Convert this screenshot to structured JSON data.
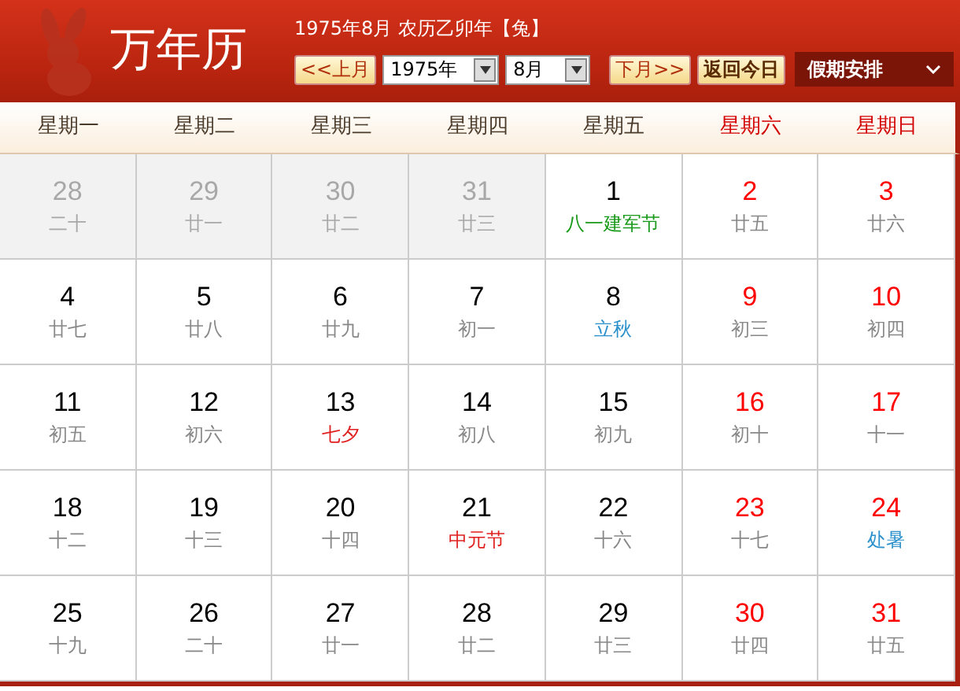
{
  "header": {
    "title": "万年历",
    "info": "1975年8月 农历乙卯年【兔】",
    "prev_button": "<<上月",
    "year_select": "1975年",
    "month_select": "8月",
    "next_button": "下月>>",
    "today_button": "返回今日",
    "holiday_menu": "假期安排"
  },
  "weekdays": [
    {
      "label": "星期一",
      "weekend": false
    },
    {
      "label": "星期二",
      "weekend": false
    },
    {
      "label": "星期三",
      "weekend": false
    },
    {
      "label": "星期四",
      "weekend": false
    },
    {
      "label": "星期五",
      "weekend": false
    },
    {
      "label": "星期六",
      "weekend": true
    },
    {
      "label": "星期日",
      "weekend": true
    }
  ],
  "weeks": [
    [
      {
        "day": "28",
        "note": "二十",
        "kind": "lunar",
        "other_month": true,
        "weekend": false
      },
      {
        "day": "29",
        "note": "廿一",
        "kind": "lunar",
        "other_month": true,
        "weekend": false
      },
      {
        "day": "30",
        "note": "廿二",
        "kind": "lunar",
        "other_month": true,
        "weekend": false
      },
      {
        "day": "31",
        "note": "廿三",
        "kind": "lunar",
        "other_month": true,
        "weekend": false
      },
      {
        "day": "1",
        "note": "八一建军节",
        "kind": "festival",
        "other_month": false,
        "weekend": false
      },
      {
        "day": "2",
        "note": "廿五",
        "kind": "lunar",
        "other_month": false,
        "weekend": true
      },
      {
        "day": "3",
        "note": "廿六",
        "kind": "lunar",
        "other_month": false,
        "weekend": true
      }
    ],
    [
      {
        "day": "4",
        "note": "廿七",
        "kind": "lunar",
        "other_month": false,
        "weekend": false
      },
      {
        "day": "5",
        "note": "廿八",
        "kind": "lunar",
        "other_month": false,
        "weekend": false
      },
      {
        "day": "6",
        "note": "廿九",
        "kind": "lunar",
        "other_month": false,
        "weekend": false
      },
      {
        "day": "7",
        "note": "初一",
        "kind": "lunar",
        "other_month": false,
        "weekend": false
      },
      {
        "day": "8",
        "note": "立秋",
        "kind": "term",
        "other_month": false,
        "weekend": false
      },
      {
        "day": "9",
        "note": "初三",
        "kind": "lunar",
        "other_month": false,
        "weekend": true
      },
      {
        "day": "10",
        "note": "初四",
        "kind": "lunar",
        "other_month": false,
        "weekend": true
      }
    ],
    [
      {
        "day": "11",
        "note": "初五",
        "kind": "lunar",
        "other_month": false,
        "weekend": false
      },
      {
        "day": "12",
        "note": "初六",
        "kind": "lunar",
        "other_month": false,
        "weekend": false
      },
      {
        "day": "13",
        "note": "七夕",
        "kind": "folk",
        "other_month": false,
        "weekend": false
      },
      {
        "day": "14",
        "note": "初八",
        "kind": "lunar",
        "other_month": false,
        "weekend": false
      },
      {
        "day": "15",
        "note": "初九",
        "kind": "lunar",
        "other_month": false,
        "weekend": false
      },
      {
        "day": "16",
        "note": "初十",
        "kind": "lunar",
        "other_month": false,
        "weekend": true
      },
      {
        "day": "17",
        "note": "十一",
        "kind": "lunar",
        "other_month": false,
        "weekend": true
      }
    ],
    [
      {
        "day": "18",
        "note": "十二",
        "kind": "lunar",
        "other_month": false,
        "weekend": false
      },
      {
        "day": "19",
        "note": "十三",
        "kind": "lunar",
        "other_month": false,
        "weekend": false
      },
      {
        "day": "20",
        "note": "十四",
        "kind": "lunar",
        "other_month": false,
        "weekend": false
      },
      {
        "day": "21",
        "note": "中元节",
        "kind": "folk",
        "other_month": false,
        "weekend": false
      },
      {
        "day": "22",
        "note": "十六",
        "kind": "lunar",
        "other_month": false,
        "weekend": false
      },
      {
        "day": "23",
        "note": "十七",
        "kind": "lunar",
        "other_month": false,
        "weekend": true
      },
      {
        "day": "24",
        "note": "处暑",
        "kind": "term",
        "other_month": false,
        "weekend": true
      }
    ],
    [
      {
        "day": "25",
        "note": "十九",
        "kind": "lunar",
        "other_month": false,
        "weekend": false
      },
      {
        "day": "26",
        "note": "二十",
        "kind": "lunar",
        "other_month": false,
        "weekend": false
      },
      {
        "day": "27",
        "note": "廿一",
        "kind": "lunar",
        "other_month": false,
        "weekend": false
      },
      {
        "day": "28",
        "note": "廿二",
        "kind": "lunar",
        "other_month": false,
        "weekend": false
      },
      {
        "day": "29",
        "note": "廿三",
        "kind": "lunar",
        "other_month": false,
        "weekend": false
      },
      {
        "day": "30",
        "note": "廿四",
        "kind": "lunar",
        "other_month": false,
        "weekend": true
      },
      {
        "day": "31",
        "note": "廿五",
        "kind": "lunar",
        "other_month": false,
        "weekend": true
      }
    ]
  ]
}
